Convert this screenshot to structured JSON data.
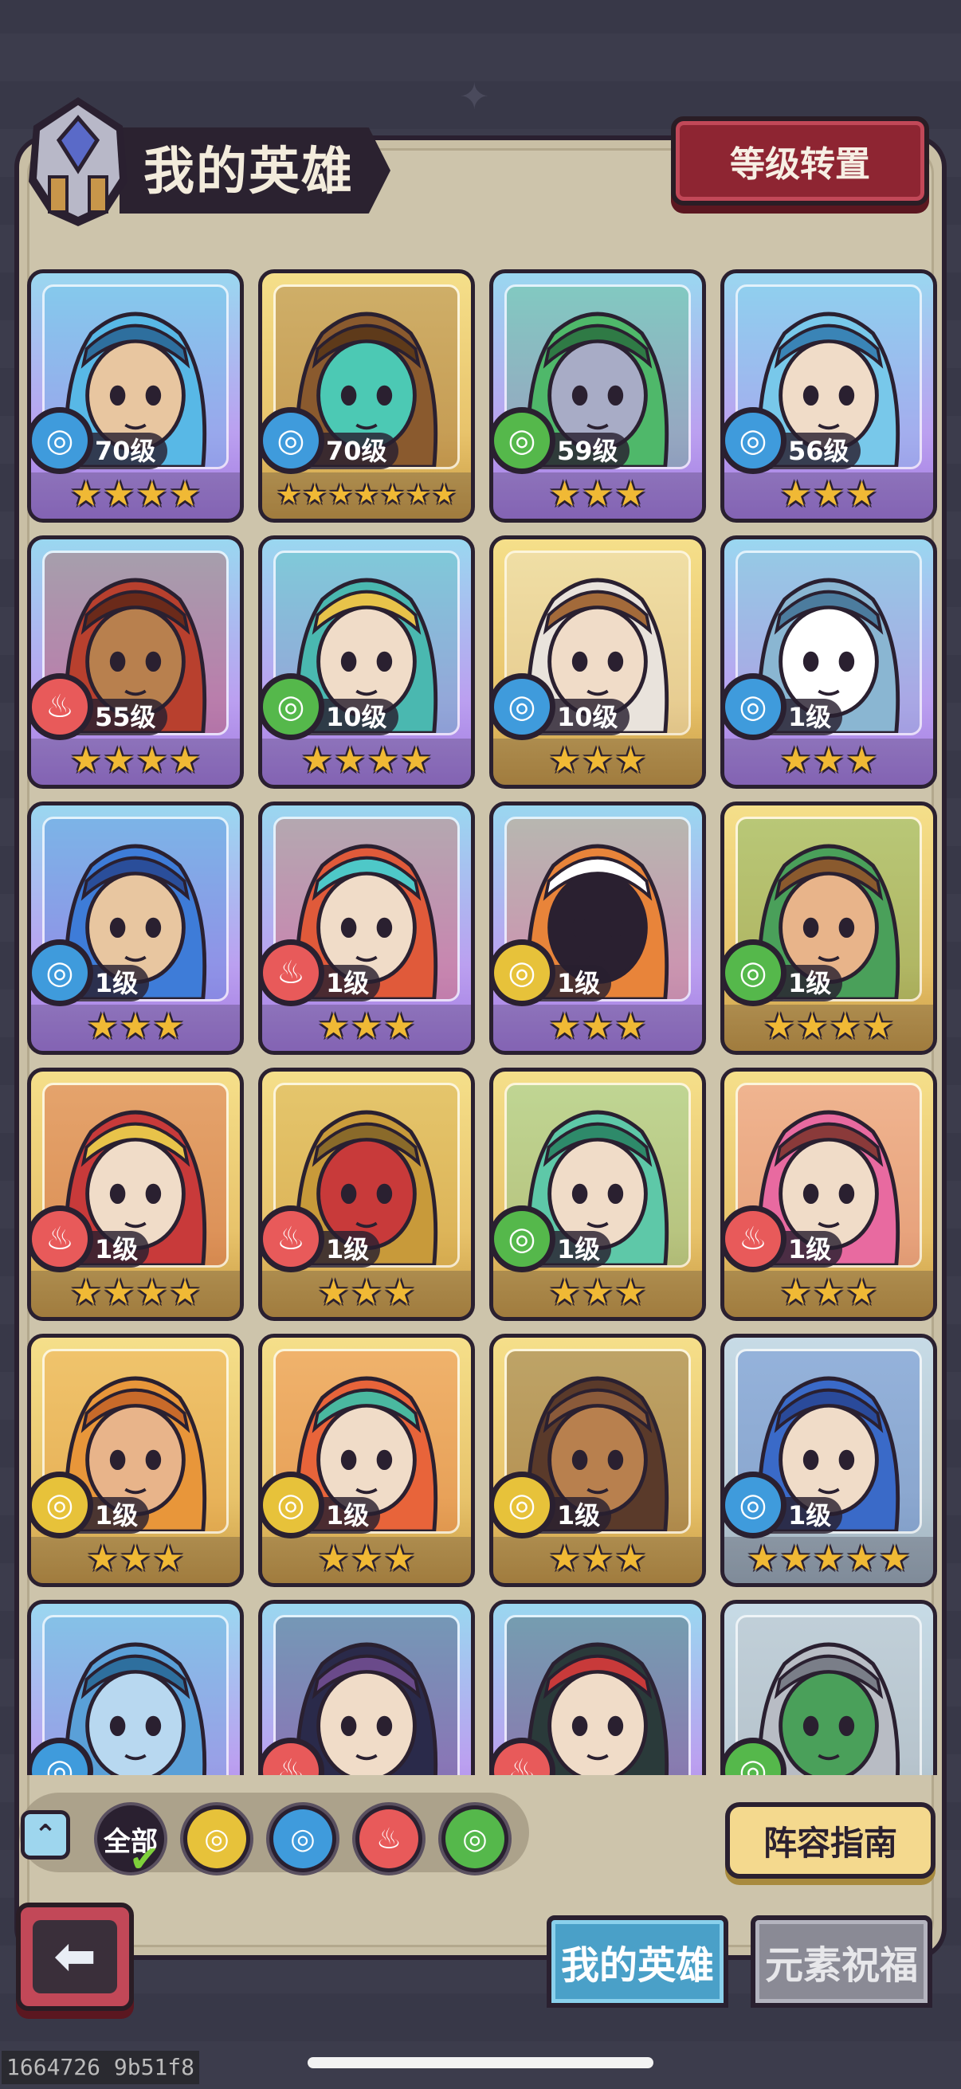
{
  "header": {
    "title": "我的英雄",
    "level_reset_label": "等级转置"
  },
  "elements": {
    "water": {
      "symbol": "◎",
      "color": "#3f9bdc"
    },
    "fire": {
      "symbol": "♨",
      "color": "#e85a5a"
    },
    "wind": {
      "symbol": "◎",
      "color": "#55b84b"
    },
    "earth": {
      "symbol": "◎",
      "color": "#e7c23a"
    }
  },
  "heroes": [
    {
      "level": "70级",
      "element": "water",
      "stars": 4,
      "rarity": "epic",
      "palette": [
        "#58b8e6",
        "#2e6f9e",
        "#e8c6a0"
      ]
    },
    {
      "level": "70级",
      "element": "water",
      "stars": 7,
      "rarity": "legend",
      "palette": [
        "#8a5a2e",
        "#5e3a1a",
        "#4cc9b4"
      ]
    },
    {
      "level": "59级",
      "element": "wind",
      "stars": 3,
      "rarity": "epic",
      "palette": [
        "#4fb86a",
        "#2f7a45",
        "#a8acc6"
      ]
    },
    {
      "level": "56级",
      "element": "water",
      "stars": 3,
      "rarity": "epic",
      "palette": [
        "#78c8ea",
        "#3a84b6",
        "#f0dcc8"
      ]
    },
    {
      "level": "55级",
      "element": "fire",
      "stars": 4,
      "rarity": "epic",
      "palette": [
        "#b8402e",
        "#6b2a1a",
        "#b8804e"
      ]
    },
    {
      "level": "10级",
      "element": "wind",
      "stars": 4,
      "rarity": "epic",
      "palette": [
        "#4ab8b0",
        "#e8c34a",
        "#f0dcc8"
      ]
    },
    {
      "level": "10级",
      "element": "water",
      "stars": 3,
      "rarity": "legend",
      "palette": [
        "#e9e3dc",
        "#a36a3a",
        "#f0dcc8"
      ]
    },
    {
      "level": "1级",
      "element": "water",
      "stars": 3,
      "rarity": "epic",
      "palette": [
        "#8ab6d2",
        "#4c7c9e",
        "#ffffff"
      ]
    },
    {
      "level": "1级",
      "element": "water",
      "stars": 3,
      "rarity": "epic",
      "palette": [
        "#3e7cd8",
        "#2a4e9a",
        "#e8c6a0"
      ]
    },
    {
      "level": "1级",
      "element": "fire",
      "stars": 3,
      "rarity": "epic",
      "palette": [
        "#e05a3a",
        "#4ec8c8",
        "#f0dcc8"
      ]
    },
    {
      "level": "1级",
      "element": "earth",
      "stars": 3,
      "rarity": "epic",
      "palette": [
        "#e8843a",
        "#ffffff",
        "#2a2030"
      ]
    },
    {
      "level": "1级",
      "element": "wind",
      "stars": 4,
      "rarity": "legend",
      "palette": [
        "#4aa05a",
        "#8a5a2e",
        "#e8b48a"
      ]
    },
    {
      "level": "1级",
      "element": "fire",
      "stars": 4,
      "rarity": "legend",
      "palette": [
        "#c83a3a",
        "#e8c34a",
        "#f0dcc8"
      ]
    },
    {
      "level": "1级",
      "element": "fire",
      "stars": 3,
      "rarity": "legend",
      "palette": [
        "#c89a3a",
        "#8a6a2a",
        "#c83a3a"
      ]
    },
    {
      "level": "1级",
      "element": "wind",
      "stars": 3,
      "rarity": "legend",
      "palette": [
        "#5ec8a8",
        "#2e8a6a",
        "#f0dcc8"
      ]
    },
    {
      "level": "1级",
      "element": "fire",
      "stars": 3,
      "rarity": "legend",
      "palette": [
        "#e86aa0",
        "#8a3a3a",
        "#f0dcc8"
      ]
    },
    {
      "level": "1级",
      "element": "earth",
      "stars": 3,
      "rarity": "legend",
      "palette": [
        "#e8963a",
        "#c86a2a",
        "#e8b48a"
      ]
    },
    {
      "level": "1级",
      "element": "earth",
      "stars": 3,
      "rarity": "legend",
      "palette": [
        "#e8643a",
        "#4ab8a0",
        "#f0dcc8"
      ]
    },
    {
      "level": "1级",
      "element": "earth",
      "stars": 3,
      "rarity": "legend",
      "palette": [
        "#5a3a2a",
        "#8a5a3a",
        "#b8804e"
      ]
    },
    {
      "level": "1级",
      "element": "water",
      "stars": 5,
      "rarity": "rare",
      "palette": [
        "#3a6ac8",
        "#2a4a9a",
        "#f0dcc8"
      ]
    },
    {
      "level": "",
      "element": "water",
      "stars": 0,
      "rarity": "epic",
      "palette": [
        "#5aa0d8",
        "#2e6f9e",
        "#b8d8f0"
      ]
    },
    {
      "level": "",
      "element": "fire",
      "stars": 0,
      "rarity": "epic",
      "palette": [
        "#2a2a4a",
        "#6a4a8a",
        "#f0dcc8"
      ]
    },
    {
      "level": "",
      "element": "fire",
      "stars": 0,
      "rarity": "epic",
      "palette": [
        "#2a3a3a",
        "#c83a3a",
        "#f0dcc8"
      ]
    },
    {
      "level": "",
      "element": "wind",
      "stars": 0,
      "rarity": "rare",
      "palette": [
        "#b8bcc4",
        "#7a7e88",
        "#4aa05a"
      ]
    }
  ],
  "filters": {
    "all_label": "全部",
    "items": [
      "earth",
      "water",
      "fire",
      "wind"
    ]
  },
  "team_guide_label": "阵容指南",
  "tabs": {
    "my_heroes": "我的英雄",
    "element_blessing": "元素祝福"
  },
  "debug_text": "1664726 9b51f8"
}
